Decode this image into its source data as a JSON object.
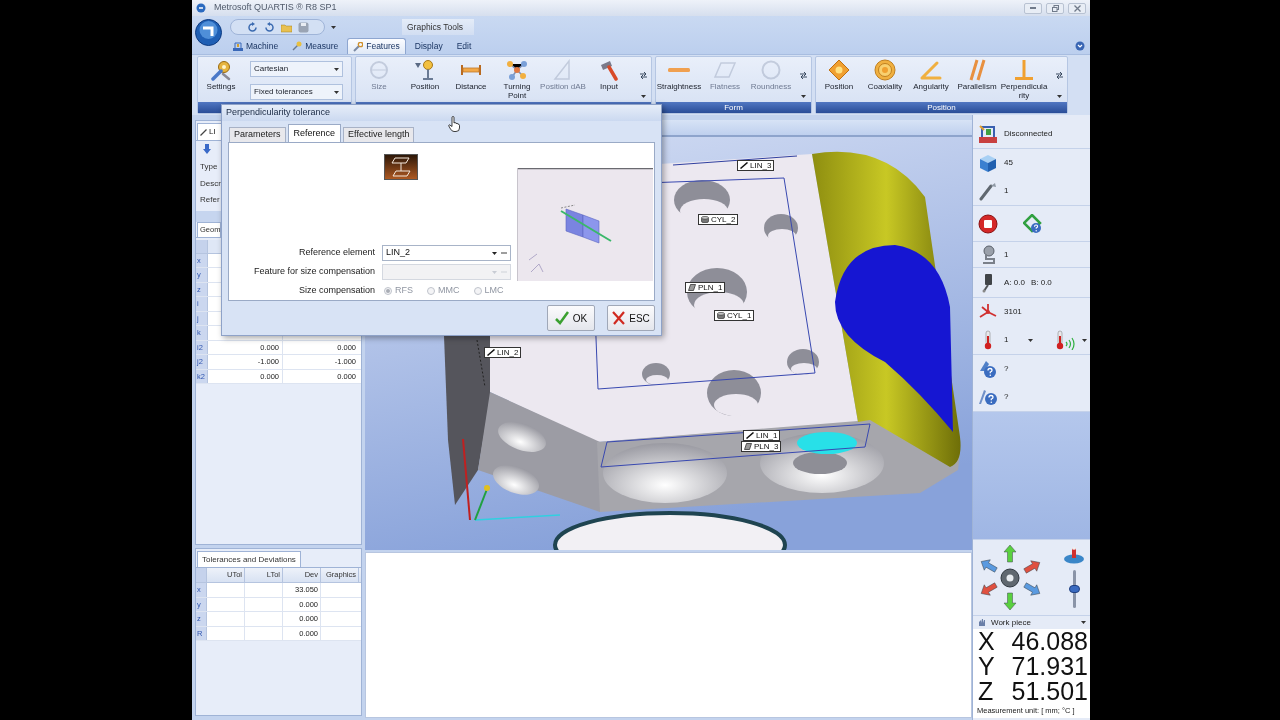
{
  "window": {
    "title": "Metrosoft QUARTIS ® R8 SP1"
  },
  "ribbon": {
    "contextual_tab": "Graphics Tools",
    "tabs": [
      {
        "label": "Machine",
        "selected": false
      },
      {
        "label": "Measure",
        "selected": false
      },
      {
        "label": "Features",
        "selected": true
      },
      {
        "label": "Display",
        "selected": false
      },
      {
        "label": "Edit",
        "selected": false
      }
    ],
    "groups": [
      {
        "buttons": [
          {
            "label": "Settings",
            "disabled": false
          }
        ],
        "dropdowns": [
          "Cartesian",
          "Fixed tolerances"
        ]
      },
      {
        "buttons": [
          {
            "label": "Size",
            "disabled": true
          },
          {
            "label": "Position",
            "disabled": false
          },
          {
            "label": "Distance",
            "disabled": false
          },
          {
            "label": "Turning Point",
            "disabled": false
          },
          {
            "label": "Position dAB",
            "disabled": true
          },
          {
            "label": "Input",
            "disabled": false
          }
        ]
      },
      {
        "label": "Form",
        "buttons": [
          {
            "label": "Straightness",
            "disabled": false
          },
          {
            "label": "Flatness",
            "disabled": true
          },
          {
            "label": "Roundness",
            "disabled": true
          }
        ]
      },
      {
        "label": "Position",
        "buttons": [
          {
            "label": "Position",
            "disabled": false
          },
          {
            "label": "Coaxiality",
            "disabled": false
          },
          {
            "label": "Angularity",
            "disabled": false
          },
          {
            "label": "Parallelism",
            "disabled": false
          },
          {
            "label": "Perpendicularity",
            "disabled": false
          }
        ]
      }
    ]
  },
  "dialog": {
    "title": "Perpendicularity tolerance",
    "tabs": [
      {
        "label": "Parameters",
        "selected": false
      },
      {
        "label": "Reference",
        "selected": true
      },
      {
        "label": "Effective length",
        "selected": false
      }
    ],
    "fields": [
      {
        "label": "Reference element",
        "value": "LIN_2",
        "disabled": false
      },
      {
        "label": "Feature for size compensation",
        "disabled": true
      }
    ],
    "size_compensation": {
      "label": "Size compensation",
      "disabled": true,
      "options": [
        {
          "label": "RFS",
          "selected": true
        },
        {
          "label": "MMC",
          "selected": false
        },
        {
          "label": "LMC",
          "selected": false
        }
      ]
    },
    "buttons": [
      {
        "label": "OK"
      },
      {
        "label": "ESC"
      }
    ]
  },
  "properties": {
    "tab": "LI",
    "fields": [
      "Type",
      "Descr",
      "Refer"
    ],
    "geometry_tab": "Geom",
    "rows": [
      {
        "header": "x"
      },
      {
        "header": "y"
      },
      {
        "header": "z"
      },
      {
        "header": "i"
      },
      {
        "header": "j"
      },
      {
        "header": "k"
      },
      {
        "header": "i2",
        "values": [
          "0.000",
          "0.000"
        ]
      },
      {
        "header": "j2",
        "values": [
          "-1.000",
          "-1.000"
        ]
      },
      {
        "header": "k2",
        "values": [
          "0.000",
          "0.000"
        ]
      }
    ]
  },
  "tolerances": {
    "tab": "Tolerances and Deviations",
    "columns": [
      "UTol",
      "LTol",
      "Dev",
      "Graphics"
    ],
    "rows": [
      {
        "header": "x",
        "dev": "33.050"
      },
      {
        "header": "y",
        "dev": "0.000"
      },
      {
        "header": "z",
        "dev": "0.000"
      },
      {
        "header": "R",
        "dev": "0.000"
      }
    ]
  },
  "view": {
    "labels": [
      {
        "text": "LIN_3",
        "kind": "line"
      },
      {
        "text": "CYL_2",
        "kind": "cylinder"
      },
      {
        "text": "PLN_1",
        "kind": "plane"
      },
      {
        "text": "CYL_1",
        "kind": "cylinder"
      },
      {
        "text": "LIN_2",
        "kind": "line"
      },
      {
        "text": "LIN_1",
        "kind": "line"
      },
      {
        "text": "PLN_3",
        "kind": "plane"
      }
    ]
  },
  "status_panel": {
    "rows": [
      {
        "texts": [
          "Disconnected"
        ]
      },
      {
        "texts": [
          "45"
        ]
      },
      {
        "texts": [
          "1"
        ]
      },
      {
        "texts": [
          "1"
        ]
      },
      {
        "texts": [
          "A: 0.0",
          "B: 0.0"
        ]
      },
      {
        "texts": [
          "3101"
        ]
      },
      {
        "texts": [
          "1"
        ]
      },
      {
        "texts": [
          "?"
        ]
      },
      {
        "texts": [
          "?"
        ]
      }
    ],
    "jog_slider": {
      "level": 0.5
    },
    "coordinate_system": "Work piece",
    "coordinates": [
      {
        "axis": "X",
        "value": "46.088"
      },
      {
        "axis": "Y",
        "value": "71.931"
      },
      {
        "axis": "Z",
        "value": "51.501"
      }
    ],
    "unit": "Measurement unit: [ mm; °C ]"
  }
}
